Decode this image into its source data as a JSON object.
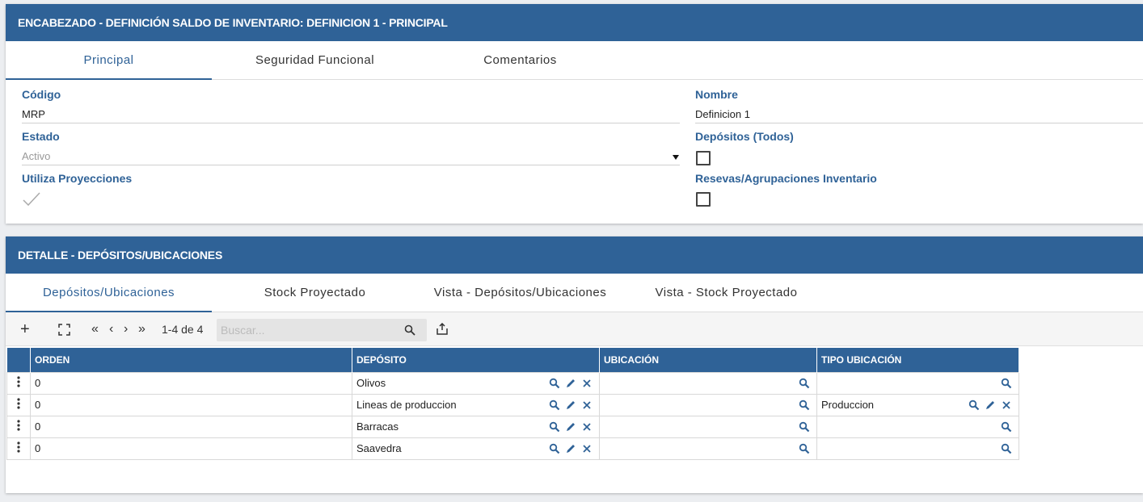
{
  "header_panel": {
    "title": "ENCABEZADO - DEFINICIÓN SALDO DE INVENTARIO: DEFINICION 1 - PRINCIPAL",
    "tabs": [
      "Principal",
      "Seguridad Funcional",
      "Comentarios"
    ],
    "fields": {
      "codigo_label": "Código",
      "codigo_value": "MRP",
      "nombre_label": "Nombre",
      "nombre_value": "Definicion 1",
      "estado_label": "Estado",
      "estado_value": "Activo",
      "depositos_label": "Depósitos (Todos)",
      "utiliza_label": "Utiliza Proyecciones",
      "reservas_label": "Resevas/Agrupaciones Inventario"
    }
  },
  "detail_panel": {
    "title": "DETALLE - DEPÓSITOS/UBICACIONES",
    "tabs": [
      "Depósitos/Ubicaciones",
      "Stock Proyectado",
      "Vista - Depósitos/Ubicaciones",
      "Vista - Stock Proyectado"
    ],
    "toolbar": {
      "pagination": "1-4 de 4",
      "search_placeholder": "Buscar..."
    },
    "table": {
      "headers": [
        "ORDEN",
        "DEPÓSITO",
        "UBICACIÓN",
        "TIPO UBICACIÓN"
      ],
      "rows": [
        {
          "orden": "0",
          "deposito": "Olivos",
          "ubicacion": "",
          "tipo": ""
        },
        {
          "orden": "0",
          "deposito": "Lineas de produccion",
          "ubicacion": "",
          "tipo": "Produccion"
        },
        {
          "orden": "0",
          "deposito": "Barracas",
          "ubicacion": "",
          "tipo": ""
        },
        {
          "orden": "0",
          "deposito": "Saavedra",
          "ubicacion": "",
          "tipo": ""
        }
      ]
    }
  },
  "colors": {
    "accent": "#2f6297"
  }
}
